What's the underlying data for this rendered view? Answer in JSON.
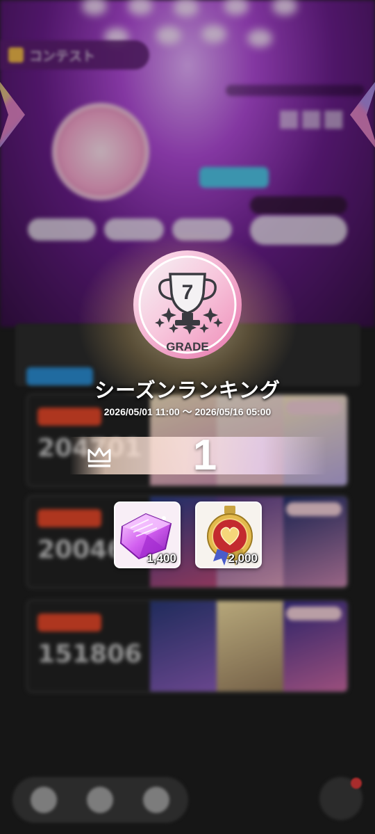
{
  "background": {
    "header_title": "コンテスト",
    "card_scores": [
      "204701",
      "200469",
      "151806"
    ]
  },
  "overlay": {
    "grade_badge": {
      "number": "7",
      "label": "GRADE"
    },
    "title": "シーズンランキング",
    "period": "2026/05/01 11:00 ～ 2026/05/16 05:00",
    "rank": "1",
    "rewards": [
      {
        "icon": "crystal-icon",
        "quantity": "1,400"
      },
      {
        "icon": "medal-icon",
        "quantity": "2,000"
      }
    ]
  },
  "colors": {
    "badge_pink": "#f2a3c8",
    "badge_silver": "#c9c9cf",
    "rank_band": "#ffe4d6",
    "stage_purple": "#b04ad8"
  }
}
